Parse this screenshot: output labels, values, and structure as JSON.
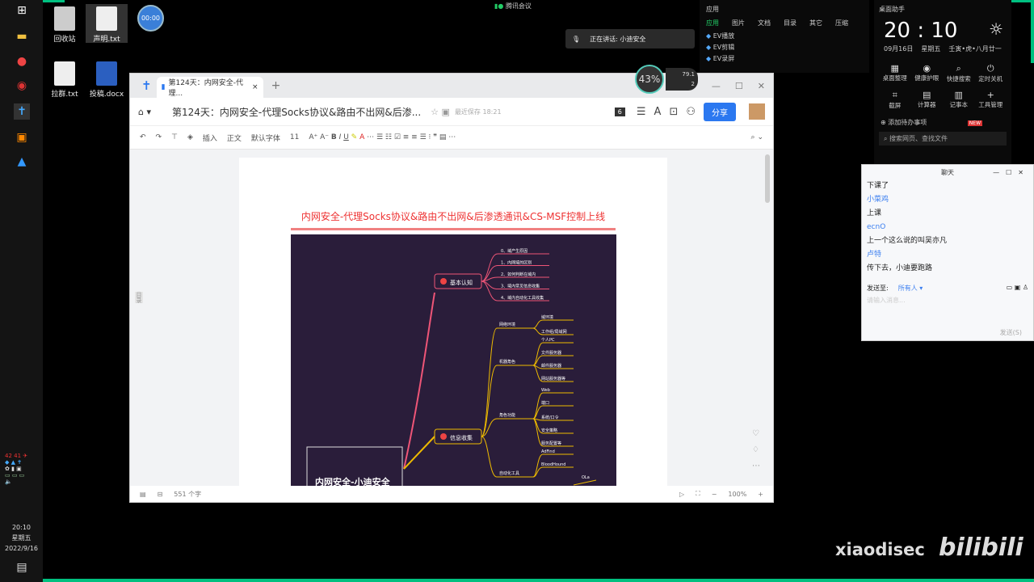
{
  "desktop": {
    "icons": [
      "回收站",
      "声明.txt",
      "拉群.txt",
      "投稿.docx"
    ],
    "timer": "00:00"
  },
  "meeting": {
    "app": "腾讯会议",
    "speaking": "正在讲话: 小迪安全"
  },
  "netmon": {
    "cpu": "43%",
    "up": "79.1",
    "down": "2"
  },
  "docwin": {
    "tab_title": "第124天：内网安全-代理...",
    "doc_title": "第124天：内网安全-代理Socks协议&路由不出网&后渗...",
    "saved": "最近保存 18:21",
    "collab_count": "6",
    "share": "分享",
    "toolbar": [
      "插入",
      "正文",
      "默认字体",
      "11"
    ],
    "heading": "内网安全-代理Socks协议&路由不出网&后渗透通讯&CS-MSF控制上线",
    "word_count": "551 个字",
    "zoom": "100%"
  },
  "mindmap": {
    "center": "内网安全-小迪安全",
    "branch1": {
      "label": "基本认知",
      "items": [
        "0、域产生原因",
        "1、内网域的区别",
        "2、如何判断在域内",
        "3、域内常见信息收集",
        "4、域内自动化工具收集"
      ]
    },
    "branch2": {
      "label": "信息收集",
      "groups": [
        {
          "label": "网络环境",
          "items": [
            "域环境",
            "工作组/局域网"
          ]
        },
        {
          "label": "机器角色",
          "items": [
            "个人PC",
            "文件服务器",
            "邮件服务器",
            "网站服务器等"
          ]
        },
        {
          "label": "角色功能",
          "items": [
            "Web",
            "端口",
            "系统/口令",
            "安全策略",
            "服务配置等"
          ]
        },
        {
          "label": "自动化工具",
          "items": [
            "AdFind",
            "BloodHound"
          ]
        }
      ],
      "extra": "OLa"
    }
  },
  "apps_panel": {
    "title": "应用",
    "tabs": [
      "应用",
      "图片",
      "文档",
      "目录",
      "其它",
      "压缩"
    ],
    "items": [
      "EV播放",
      "EV剪辑",
      "EV录屏"
    ]
  },
  "assistant": {
    "title": "桌面助手",
    "time": "20 : 10",
    "date": "09月16日",
    "weekday": "星期五",
    "lunar": "壬寅•虎•八月廿一",
    "tools": [
      "桌面整理",
      "健康护眼",
      "快捷搜索",
      "定时关机",
      "截屏",
      "计算器",
      "记事本",
      "工具管理"
    ],
    "todo": "添加待办事项",
    "new_badge": "NEW",
    "search_placeholder": "搜索网页、查找文件"
  },
  "chat": {
    "title": "聊天",
    "messages": [
      {
        "text": "下课了"
      },
      {
        "nick": "小菜鸡"
      },
      {
        "text": "上课"
      },
      {
        "nick": "ecnO"
      },
      {
        "text": "上一个这么说的叫吴亦凡"
      },
      {
        "nick": "卢特"
      },
      {
        "text": "传下去，小迪要跑路"
      }
    ],
    "send_to_label": "发送至:",
    "send_to": "所有人",
    "input_placeholder": "请输入消息...",
    "send": "发送(S)"
  },
  "clock": {
    "time": "20:10",
    "weekday": "星期五",
    "date": "2022/9/16"
  },
  "watermark": {
    "user": "xiaodisec",
    "brand": "bilibili"
  }
}
